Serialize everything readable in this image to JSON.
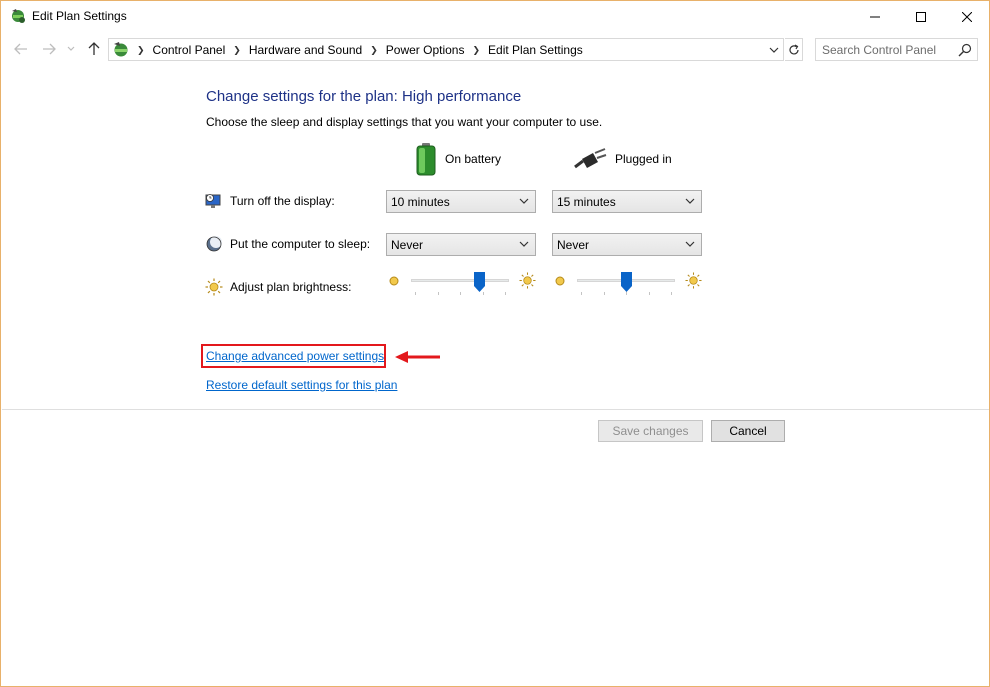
{
  "window": {
    "title": "Edit Plan Settings",
    "controls": {
      "minimize": "minimize-icon",
      "maximize": "maximize-icon",
      "close": "close-icon"
    }
  },
  "nav": {
    "breadcrumbs": [
      "Control Panel",
      "Hardware and Sound",
      "Power Options",
      "Edit Plan Settings"
    ],
    "search_placeholder": "Search Control Panel"
  },
  "page": {
    "heading": "Change settings for the plan: High performance",
    "subtext": "Choose the sleep and display settings that you want your computer to use.",
    "columns": {
      "battery": "On battery",
      "plugged": "Plugged in"
    },
    "rows": {
      "display": {
        "label": "Turn off the display:",
        "battery": "10 minutes",
        "plugged": "15 minutes"
      },
      "sleep": {
        "label": "Put the computer to sleep:",
        "battery": "Never",
        "plugged": "Never"
      },
      "brightness": {
        "label": "Adjust plan brightness:",
        "battery_level": 0.7,
        "plugged_level": 0.5
      }
    },
    "links": {
      "advanced": "Change advanced power settings",
      "restore": "Restore default settings for this plan"
    },
    "buttons": {
      "save": "Save changes",
      "cancel": "Cancel"
    }
  },
  "colors": {
    "heading": "#1e3287",
    "link": "#0066cc",
    "highlight": "#e3181c",
    "slider_thumb": "#0a64c8"
  }
}
